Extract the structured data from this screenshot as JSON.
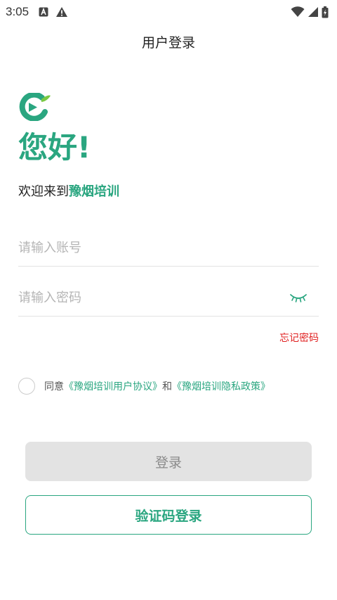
{
  "status_bar": {
    "time": "3:05",
    "icons": [
      "notification-a-icon",
      "warning-icon",
      "wifi-icon",
      "signal-icon",
      "battery-icon"
    ]
  },
  "header": {
    "title": "用户登录"
  },
  "hero": {
    "logo_icon": "app-logo-icon",
    "greeting": "您好!",
    "welcome_prefix": "欢迎来到",
    "brand_name": "豫烟培训"
  },
  "form": {
    "account_placeholder": "请输入账号",
    "account_value": "",
    "password_placeholder": "请输入密码",
    "password_value": "",
    "forgot_password": "忘记密码"
  },
  "agreement": {
    "checked": false,
    "prefix": "同意",
    "user_agreement": "《豫烟培训用户协议》",
    "conjunction": "和",
    "privacy_policy": "《豫烟培训隐私政策》"
  },
  "buttons": {
    "login": "登录",
    "code_login": "验证码登录"
  },
  "colors": {
    "brand": "#2aa680",
    "danger": "#e02020",
    "disabled_bg": "#e3e3e3"
  }
}
